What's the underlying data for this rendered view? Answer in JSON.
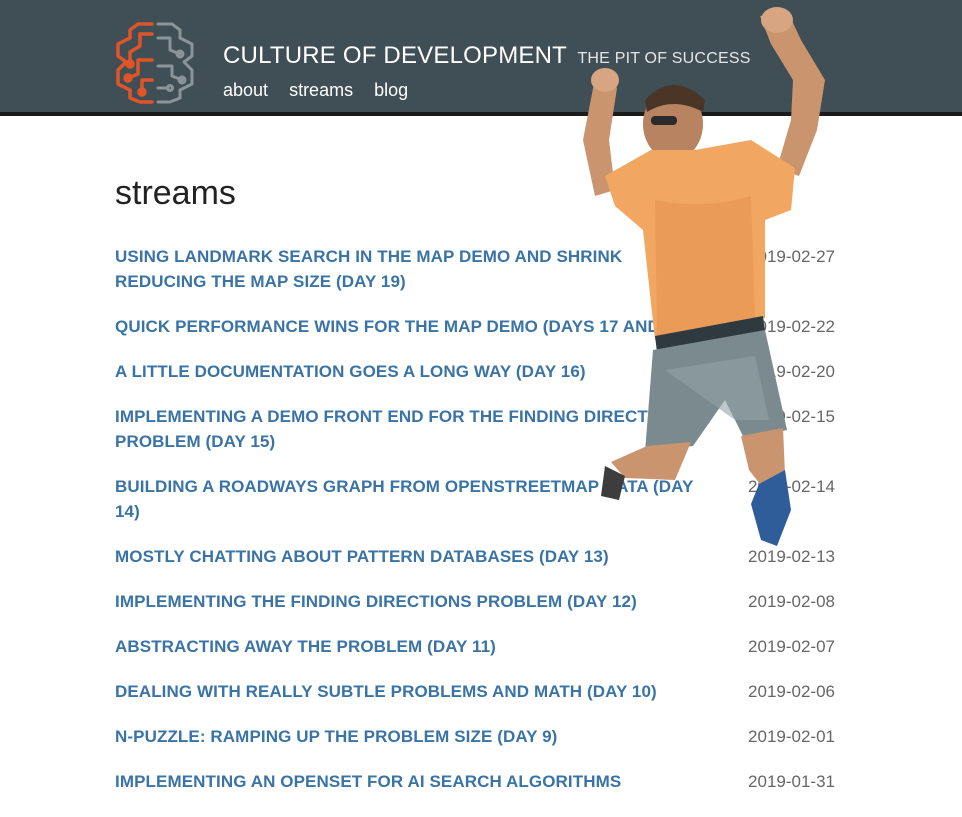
{
  "header": {
    "title": "CULTURE OF DEVELOPMENT",
    "tagline": "THE PIT OF SUCCESS",
    "nav": [
      {
        "label": "about"
      },
      {
        "label": "streams"
      },
      {
        "label": "blog"
      }
    ]
  },
  "main": {
    "heading": "streams",
    "posts": [
      {
        "title": "USING LANDMARK SEARCH IN THE MAP DEMO AND SHRINK REDUCING THE MAP SIZE (DAY 19)",
        "date": "2019-02-27"
      },
      {
        "title": "QUICK PERFORMANCE WINS FOR THE MAP DEMO (DAYS 17 AND 18)",
        "date": "2019-02-22"
      },
      {
        "title": "A LITTLE DOCUMENTATION GOES A LONG WAY (DAY 16)",
        "date": "2019-02-20"
      },
      {
        "title": "IMPLEMENTING A DEMO FRONT END FOR THE FINDING DIRECTIONS PROBLEM (DAY 15)",
        "date": "2019-02-15"
      },
      {
        "title": "BUILDING A ROADWAYS GRAPH FROM OPENSTREETMAP DATA (DAY 14)",
        "date": "2019-02-14"
      },
      {
        "title": "MOSTLY CHATTING ABOUT PATTERN DATABASES (DAY 13)",
        "date": "2019-02-13"
      },
      {
        "title": "IMPLEMENTING THE FINDING DIRECTIONS PROBLEM (DAY 12)",
        "date": "2019-02-08"
      },
      {
        "title": "ABSTRACTING AWAY THE PROBLEM (DAY 11)",
        "date": "2019-02-07"
      },
      {
        "title": "DEALING WITH REALLY SUBTLE PROBLEMS AND MATH (DAY 10)",
        "date": "2019-02-06"
      },
      {
        "title": "N-PUZZLE: RAMPING UP THE PROBLEM SIZE (DAY 9)",
        "date": "2019-02-01"
      },
      {
        "title": "IMPLEMENTING AN OPENSET FOR AI SEARCH ALGORITHMS",
        "date": "2019-01-31"
      }
    ]
  },
  "colors": {
    "header_bg": "#3f4f55",
    "link": "#3a73a5",
    "logo_orange": "#e0542a",
    "logo_gray": "#8a9499"
  },
  "icons": {
    "logo": "brain-circuit-logo"
  }
}
